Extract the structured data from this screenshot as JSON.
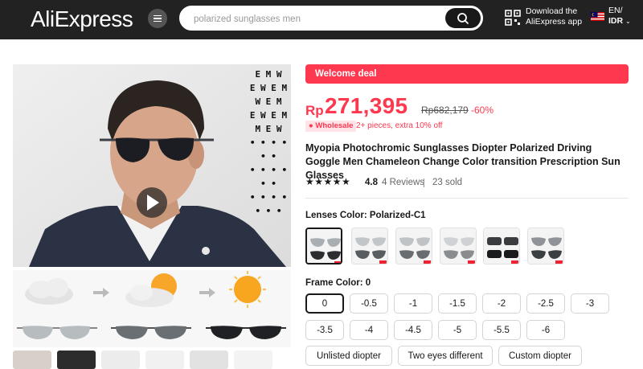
{
  "header": {
    "logo": "AliExpress",
    "search_placeholder": "polarized sunglasses men",
    "download_line1": "Download the",
    "download_line2": "AliExpress app",
    "lang_line1": "EN/",
    "lang_line2": "IDR"
  },
  "deal": {
    "label": "Welcome deal"
  },
  "price": {
    "currency": "Rp",
    "current": "271,395",
    "original": "Rp682,179",
    "discount": "-60%"
  },
  "wholesale": {
    "badge": "Wholesale",
    "note": "2+ pieces, extra 10% off"
  },
  "product": {
    "title": "Myopia Photochromic Sunglasses Diopter Polarized Driving Goggle Men Chameleon Change Color transition Prescription Sun Glasses",
    "rating": "4.8",
    "stars": "★★★★★",
    "reviews": "4 Reviews",
    "sold": "23 sold"
  },
  "gallery": {
    "eye_chart": [
      "E M W",
      "E W E M",
      "W E M",
      "E W E M",
      "M E W",
      "• • • • • •",
      "• • • • • •",
      "• • • • • • •"
    ]
  },
  "lens_color": {
    "label": "Lenses Color: Polarized-C1",
    "options_count": 6,
    "selected_index": 0
  },
  "frame_color": {
    "label": "Frame Color: 0",
    "selected": "0",
    "options": [
      "0",
      "-0.5",
      "-1",
      "-1.5",
      "-2",
      "-2.5",
      "-3",
      "-3.5",
      "-4",
      "-4.5",
      "-5",
      "-5.5",
      "-6",
      "Unlisted diopter",
      "Two eyes different",
      "Custom diopter"
    ]
  },
  "colors": {
    "accent": "#fd384f",
    "header_bg": "#222222",
    "text": "#191919"
  }
}
